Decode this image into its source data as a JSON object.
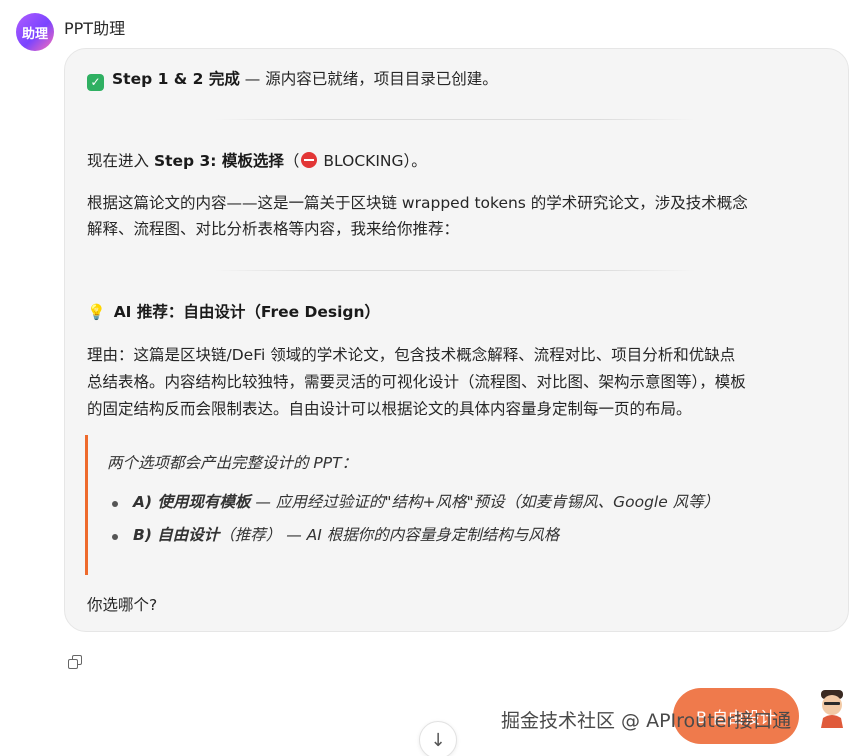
{
  "header": {
    "avatar_text": "助理",
    "sender_name": "PPT助理"
  },
  "message": {
    "status_prefix": "Step 1 & 2 完成",
    "status_rest": " — 源内容已就绪，项目目录已创建。",
    "step_prefix": "现在进入 ",
    "step_bold": "Step 3: 模板选择",
    "step_paren_open": "（",
    "step_blocking": "BLOCKING）。",
    "intro_line1": "根据这篇论文的内容——这是一篇关于区块链 wrapped tokens 的学术研究论文，涉及技术概念",
    "intro_line2": "解释、流程图、对比分析表格等内容，我来给你推荐：",
    "recommend_title": "AI 推荐：自由设计（Free Design）",
    "reason_line1": "理由：这篇是区块链/DeFi 领域的学术论文，包含技术概念解释、流程对比、项目分析和优缺点",
    "reason_line2": "总结表格。内容结构比较独特，需要灵活的可视化设计（流程图、对比图、架构示意图等），模板",
    "reason_line3": "的固定结构反而会限制表达。自由设计可以根据论文的具体内容量身定制每一页的布局。",
    "quote_intro": "两个选项都会产出完整设计的 PPT：",
    "options": [
      {
        "label": "A) 使用现有模板",
        "desc": " — 应用经过验证的\"结构+风格\"预设（如麦肯锡风、Google 风等）"
      },
      {
        "label": "B) 自由设计",
        "desc": "（推荐） — AI 根据你的内容量身定制结构与风格"
      }
    ],
    "question": "你选哪个?"
  },
  "reply_button": "B 自由设计",
  "watermark": "掘金技术社区 @ APIrouter接口通",
  "colors": {
    "accent": "#ef7a4c",
    "quote_border": "#ee6a2c",
    "check": "#2fb062",
    "stop": "#e23636"
  },
  "icons": {
    "copy": "copy-icon",
    "scroll": "arrow-down-icon",
    "check": "check-mark-icon",
    "stop": "no-entry-icon",
    "bulb": "light-bulb-icon"
  }
}
